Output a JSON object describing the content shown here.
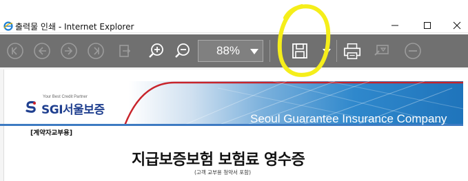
{
  "window": {
    "title": "출력물 인쇄 - Internet Explorer"
  },
  "toolbar": {
    "zoom_value": "88%",
    "buttons": {
      "first": "first-page-icon",
      "prev": "previous-page-icon",
      "next": "next-page-icon",
      "last": "last-page-icon",
      "export": "export-icon",
      "zoom_in": "zoom-in-icon",
      "zoom_out": "zoom-out-icon",
      "save": "save-icon",
      "print": "print-icon",
      "find": "find-icon",
      "close": "close-icon"
    }
  },
  "document": {
    "logo_tagline": "Your Best Credit Partner",
    "logo_text": "SGI서울보증",
    "banner_text": "Seoul Guarantee Insurance Company",
    "copy_label": "[계약자교부용]",
    "title": "지급보증보험 보험료 영수증",
    "subtitle": "(고객 교부용 청약서 포함)"
  },
  "colors": {
    "toolbar_bg": "#707070",
    "highlight": "#f5ee1a",
    "brand_blue": "#1f3f8f",
    "brand_red": "#d1232a",
    "banner_blue": "#2f88cc"
  }
}
